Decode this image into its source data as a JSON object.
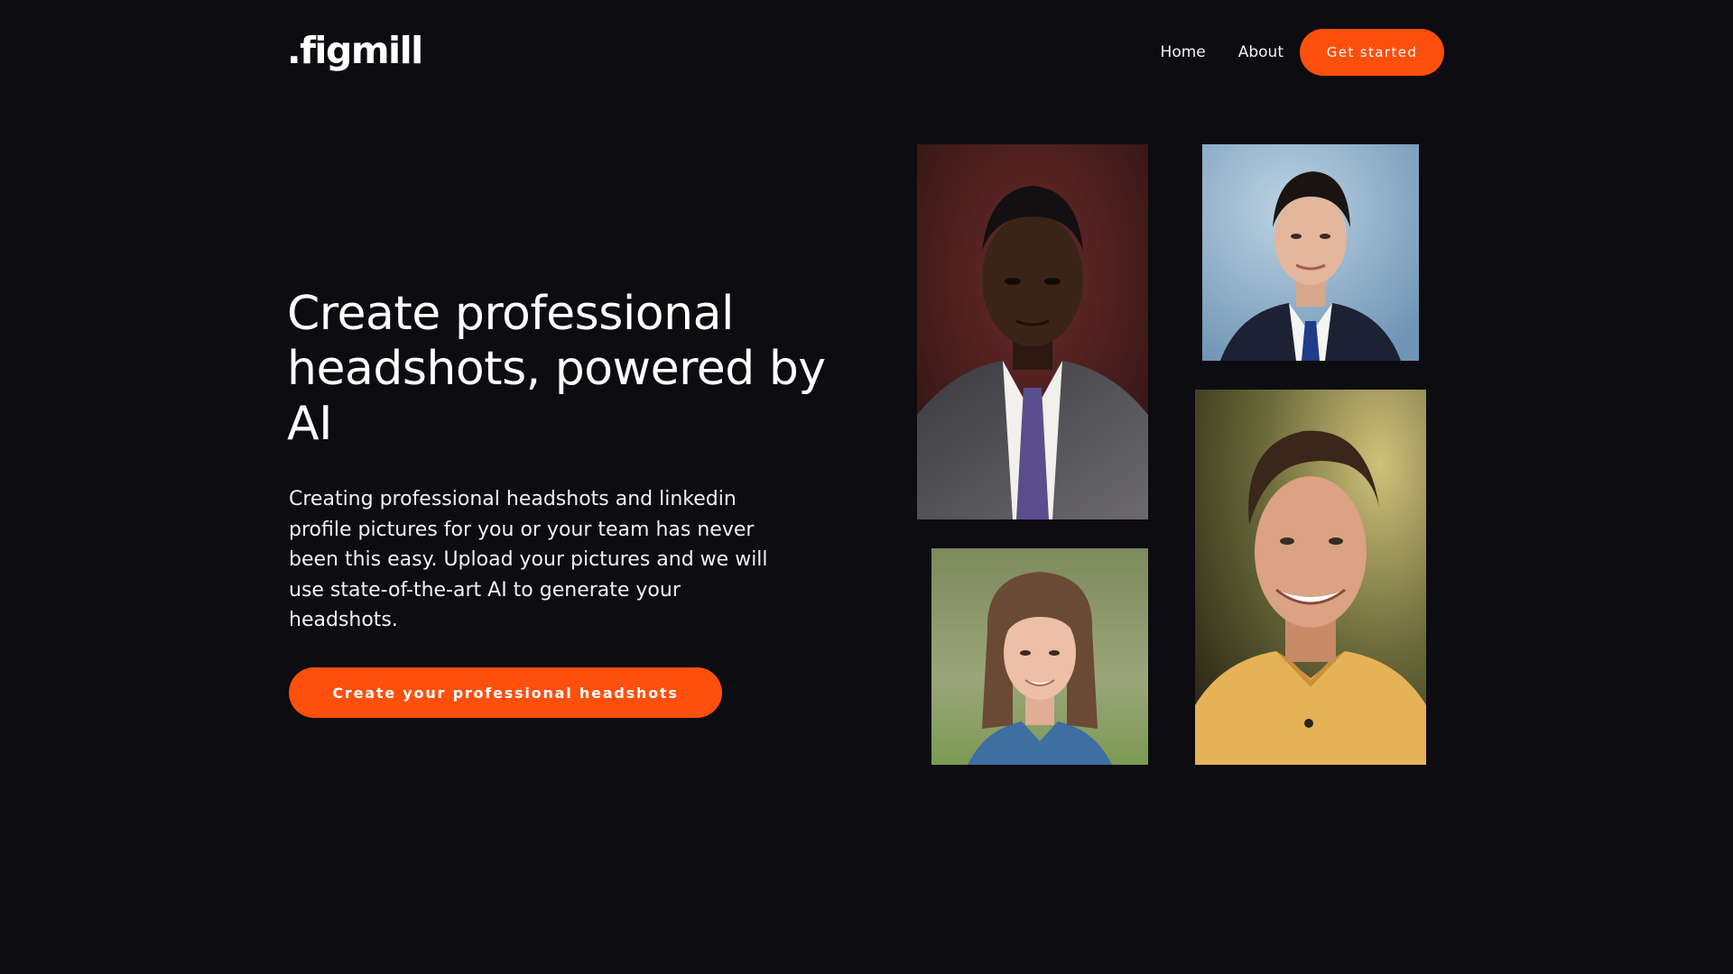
{
  "header": {
    "logo": ".figmill",
    "nav": [
      {
        "label": "Home"
      },
      {
        "label": "About"
      }
    ],
    "cta_label": "Get started"
  },
  "hero": {
    "title": "Create professional headshots, powered by AI",
    "description": "Creating professional headshots and linkedin profile pictures for you or your team has never been this easy. Upload your pictures and we will use state-of-the-art AI to generate your headshots.",
    "cta_label": "Create your professional headshots"
  },
  "gallery": [
    {
      "icon": "headshot-portrait-man-suit-purple-tie"
    },
    {
      "icon": "headshot-portrait-man-suit-blue-background"
    },
    {
      "icon": "headshot-portrait-man-yellow-polo"
    },
    {
      "icon": "headshot-portrait-woman-denim-jacket"
    }
  ],
  "colors": {
    "background": "#0d0c10",
    "accent": "#ff4f0d",
    "text": "#ffffff"
  }
}
